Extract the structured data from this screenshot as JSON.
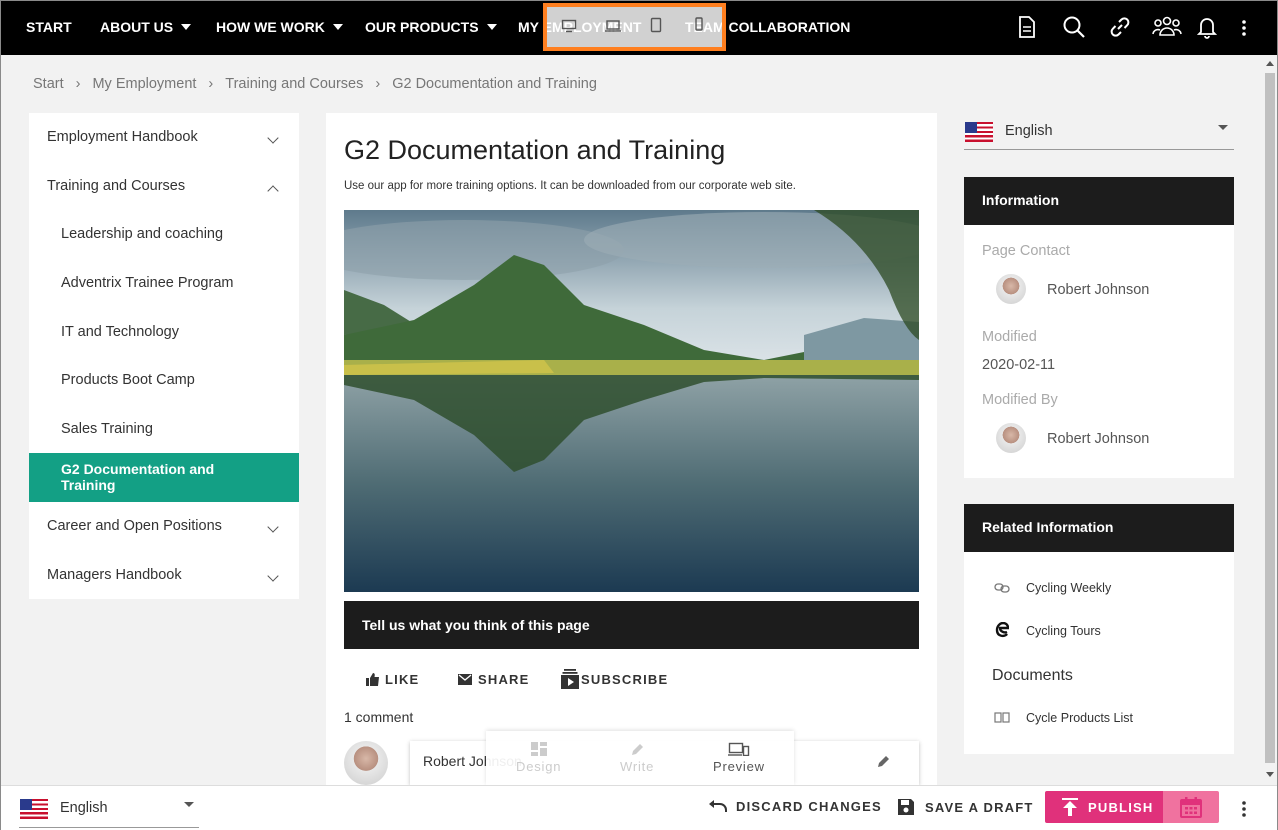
{
  "nav": {
    "items": [
      {
        "label": "START",
        "caret": false
      },
      {
        "label": "ABOUT US",
        "caret": true
      },
      {
        "label": "HOW WE WORK",
        "caret": true
      },
      {
        "label": "OUR PRODUCTS",
        "caret": true
      },
      {
        "label": "MY EMPLOYMENT",
        "caret": false
      },
      {
        "label": "TEAM COLLABORATION",
        "caret": false
      }
    ],
    "icons": [
      "document-icon",
      "search-icon",
      "link-icon",
      "people-icon",
      "bell-icon",
      "more-vertical-icon"
    ],
    "device_preview": [
      "desktop-icon",
      "laptop-icon",
      "tablet-icon",
      "phone-icon"
    ]
  },
  "breadcrumb": [
    "Start",
    "My Employment",
    "Training and Courses",
    "G2 Documentation and Training"
  ],
  "sidebar": {
    "items": [
      {
        "label": "Employment Handbook"
      },
      {
        "label": "Training and Courses"
      },
      {
        "label": "Leadership and coaching"
      },
      {
        "label": "Adventrix Trainee Program"
      },
      {
        "label": "IT and Technology"
      },
      {
        "label": "Products Boot Camp"
      },
      {
        "label": "Sales Training"
      },
      {
        "label": "G2 Documentation and Training"
      },
      {
        "label": "Career and Open Positions"
      },
      {
        "label": "Managers Handbook"
      }
    ]
  },
  "main": {
    "title": "G2 Documentation and Training",
    "subtitle": "Use our app for more training options. It can be downloaded from our corporate web site.",
    "feedback": "Tell us what you think of this page",
    "actions": {
      "like": "LIKE",
      "share": "SHARE",
      "subscribe": "SUBSCRIBE"
    },
    "comments_count": "1 comment",
    "comment_author": "Robert Johnson"
  },
  "editor_toolbar": {
    "design": "Design",
    "write": "Write",
    "preview": "Preview"
  },
  "right": {
    "language": "English",
    "info_title": "Information",
    "page_contact_label": "Page Contact",
    "page_contact": "Robert Johnson",
    "modified_label": "Modified",
    "modified": "2020-02-11",
    "modified_by_label": "Modified By",
    "modified_by": "Robert Johnson",
    "related_title": "Related Information",
    "links": [
      "Cycling Weekly",
      "Cycling Tours"
    ],
    "documents_title": "Documents",
    "documents": [
      "Cycle Products List"
    ]
  },
  "bottom": {
    "language": "English",
    "discard": "DISCARD CHANGES",
    "save": "SAVE A DRAFT",
    "publish": "PUBLISH"
  },
  "colors": {
    "accent": "#13a085",
    "publish": "#e0317b",
    "publish_light": "#f0729f",
    "highlight": "#ff7f1f"
  }
}
